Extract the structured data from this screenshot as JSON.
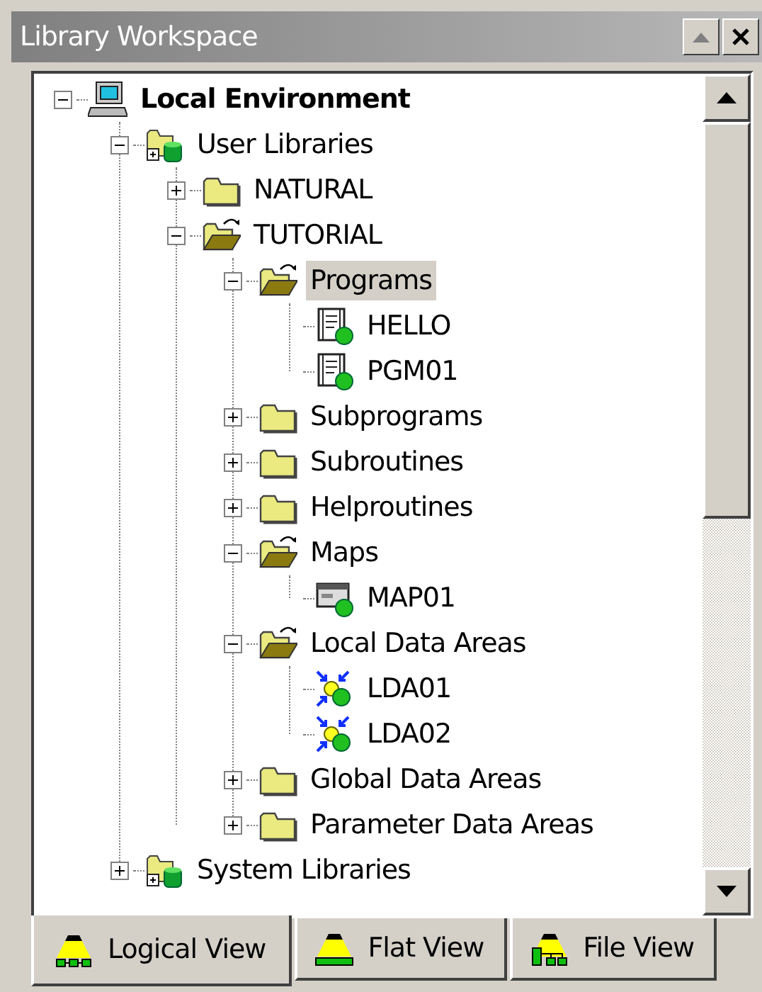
{
  "window": {
    "title": "Library Workspace"
  },
  "tree": [
    {
      "label": "Local Environment",
      "kind": "computer",
      "expanded": true,
      "bold": true,
      "selected": false,
      "children": [
        {
          "label": "User Libraries",
          "kind": "library",
          "expanded": true,
          "selected": false,
          "children": [
            {
              "label": "NATURAL",
              "kind": "folder",
              "expanded": false,
              "selected": false
            },
            {
              "label": "TUTORIAL",
              "kind": "folder",
              "expanded": true,
              "selected": false,
              "children": [
                {
                  "label": "Programs",
                  "kind": "folder",
                  "expanded": true,
                  "selected": true,
                  "children": [
                    {
                      "label": "HELLO",
                      "kind": "program",
                      "selected": false
                    },
                    {
                      "label": "PGM01",
                      "kind": "program",
                      "selected": false
                    }
                  ]
                },
                {
                  "label": "Subprograms",
                  "kind": "folder",
                  "expanded": false,
                  "selected": false
                },
                {
                  "label": "Subroutines",
                  "kind": "folder",
                  "expanded": false,
                  "selected": false
                },
                {
                  "label": "Helproutines",
                  "kind": "folder",
                  "expanded": false,
                  "selected": false
                },
                {
                  "label": "Maps",
                  "kind": "folder",
                  "expanded": true,
                  "selected": false,
                  "children": [
                    {
                      "label": "MAP01",
                      "kind": "map",
                      "selected": false
                    }
                  ]
                },
                {
                  "label": "Local Data Areas",
                  "kind": "folder",
                  "expanded": true,
                  "selected": false,
                  "children": [
                    {
                      "label": "LDA01",
                      "kind": "data-area",
                      "selected": false
                    },
                    {
                      "label": "LDA02",
                      "kind": "data-area",
                      "selected": false
                    }
                  ]
                },
                {
                  "label": "Global Data Areas",
                  "kind": "folder",
                  "expanded": false,
                  "selected": false
                },
                {
                  "label": "Parameter Data Areas",
                  "kind": "folder",
                  "expanded": false,
                  "selected": false
                }
              ]
            }
          ]
        },
        {
          "label": "System Libraries",
          "kind": "library",
          "expanded": false,
          "selected": false
        }
      ]
    }
  ],
  "tabs": [
    {
      "label": "Logical View",
      "kind": "logical",
      "selected": true
    },
    {
      "label": "Flat View",
      "kind": "flat",
      "selected": false
    },
    {
      "label": "File View",
      "kind": "file",
      "selected": false
    }
  ]
}
